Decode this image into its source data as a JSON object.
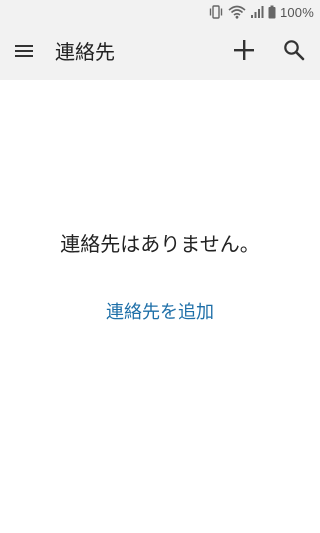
{
  "status_bar": {
    "battery_text": "100%",
    "icons": [
      "vibrate-icon",
      "wifi-icon",
      "signal-icon",
      "battery-icon"
    ]
  },
  "app_bar": {
    "title": "連絡先",
    "icons": [
      "menu-icon",
      "add-icon",
      "search-icon"
    ]
  },
  "main": {
    "empty_message": "連絡先はありません。",
    "add_contact_label": "連絡先を追加"
  },
  "colors": {
    "bar_background": "#f2f2f2",
    "link": "#1e6fa8"
  }
}
